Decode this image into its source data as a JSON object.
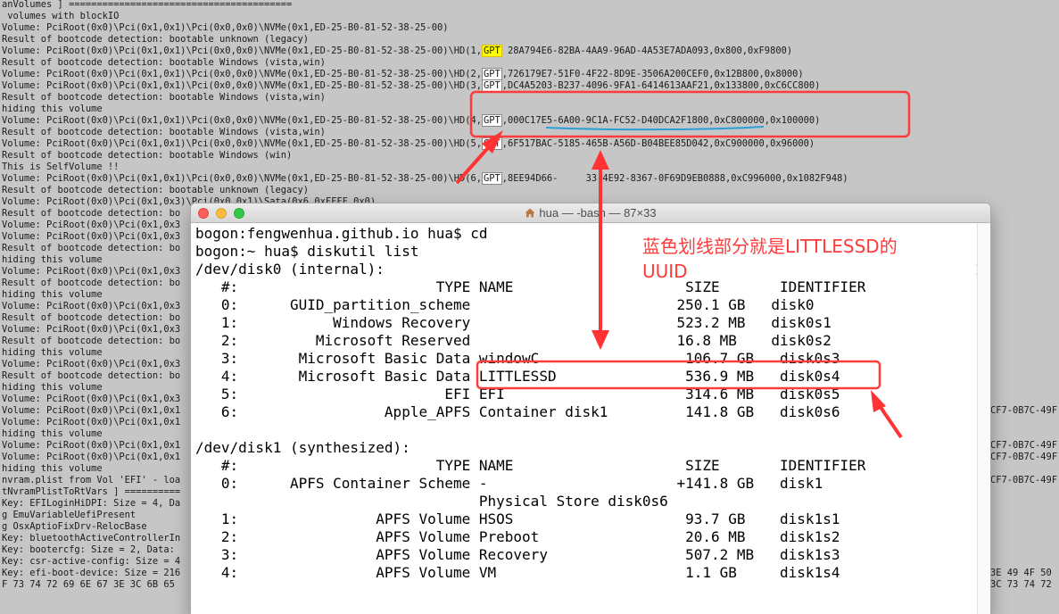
{
  "background_log": {
    "lines": [
      "anVolumes ] ========================================",
      " volumes with blockIO",
      "Volume: PciRoot(0x0)\\Pci(0x1,0x1)\\Pci(0x0,0x0)\\NVMe(0x1,ED-25-B0-81-52-38-25-00)",
      "Result of bootcode detection: bootable unknown (legacy)",
      "Volume: PciRoot(0x0)\\Pci(0x1,0x1)\\Pci(0x0,0x0)\\NVMe(0x1,ED-25-B0-81-52-38-25-00)\\HD(1,",
      "Result of bootcode detection: bootable Windows (vista,win)",
      "Volume: PciRoot(0x0)\\Pci(0x1,0x1)\\Pci(0x0,0x0)\\NVMe(0x1,ED-25-B0-81-52-38-25-00)\\HD(2,",
      "Volume: PciRoot(0x0)\\Pci(0x1,0x1)\\Pci(0x0,0x0)\\NVMe(0x1,ED-25-B0-81-52-38-25-00)\\HD(3,",
      "Result of bootcode detection: bootable Windows (vista,win)",
      "hiding this volume",
      "Volume: PciRoot(0x0)\\Pci(0x1,0x1)\\Pci(0x0,0x0)\\NVMe(0x1,ED-25-B0-81-52-38-25-00)\\HD(4,",
      "Result of bootcode detection: bootable Windows (vista,win)",
      "Volume: PciRoot(0x0)\\Pci(0x1,0x1)\\Pci(0x0,0x0)\\NVMe(0x1,ED-25-B0-81-52-38-25-00)\\HD(5,",
      "Result of bootcode detection: bootable Windows (win)",
      "This is SelfVolume !!",
      "Volume: PciRoot(0x0)\\Pci(0x1,0x1)\\Pci(0x0,0x0)\\NVMe(0x1,ED-25-B0-81-52-38-25-00)\\HD(6,",
      "Result of bootcode detection: bootable unknown (legacy)",
      "Volume: PciRoot(0x0)\\Pci(0x1,0x3)\\Pci(0x0,0x1)\\Sata(0x6,0xFFFF,0x0)",
      "Result of bootcode detection: bo",
      "Volume: PciRoot(0x0)\\Pci(0x1,0x3",
      "Volume: PciRoot(0x0)\\Pci(0x1,0x3",
      "Result of bootcode detection: bo",
      "hiding this volume",
      "Volume: PciRoot(0x0)\\Pci(0x1,0x3",
      "Result of bootcode detection: bo",
      "hiding this volume",
      "Volume: PciRoot(0x0)\\Pci(0x1,0x3",
      "Result of bootcode detection: bo",
      "Volume: PciRoot(0x0)\\Pci(0x1,0x3",
      "Result of bootcode detection: bo",
      "hiding this volume",
      "Volume: PciRoot(0x0)\\Pci(0x1,0x3",
      "Result of bootcode detection: bo",
      "hiding this volume",
      "Volume: PciRoot(0x0)\\Pci(0x1,0x3",
      "Volume: PciRoot(0x0)\\Pci(0x1,0x1",
      "Volume: PciRoot(0x0)\\Pci(0x1,0x1",
      "hiding this volume",
      "Volume: PciRoot(0x0)\\Pci(0x1,0x1",
      "Volume: PciRoot(0x0)\\Pci(0x1,0x1",
      "hiding this volume",
      "nvram.plist from Vol 'EFI' - loa",
      "tNvramPlistToRtVars ] ==========",
      "Key: EFILoginHiDPI: Size = 4, Da",
      "g EmuVariableUefiPresent",
      "g OsxAptioFixDrv-RelocBase",
      "Key: bluetoothActiveControllerIn",
      "Key: bootercfg: Size = 2, Data:",
      "Key: csr-active-config: Size = 4",
      "Key: efi-boot-device: Size = 216",
      "F 73 74 72 69 6E 67 3E 3C 6B 65"
    ],
    "gpt_label": "GPT",
    "gpt_rows": [
      {
        "guid": "28A794E6-82BA-4AA9-96AD-4A53E7ADA093",
        "tail": ",0x800,0xF9800)"
      },
      {
        "guid": "726179E7-51F0-4F22-8D9E-3506A200CEF0",
        "tail": ",0x12B800,0x8000)"
      },
      {
        "guid": "DC4A5203-B237-4096-9FA1-6414613AAF21",
        "tail": ",0x133800,0xC6CC800)"
      },
      {
        "guid": "000C17E5-6A00-9C1A-FC52-D40DCA2F1800",
        "tail": ",0xC800000,0x100000)"
      },
      {
        "guid": "6F517BAC-5185-465B-A56D-B04BEE85D042",
        "tail": ",0xC900000,0x96000)"
      },
      {
        "guid": "8EE94D66-     33-4E92-8367-0F69D9EB0888",
        "tail": ",0xC996000,0x1082F948)"
      }
    ],
    "right_fragments": [
      "CF7-0B7C-49F",
      "CF7-0B7C-49F",
      "CF7-0B7C-49F",
      "CF7-0B7C-49F",
      "3E 49 4F 50",
      "3C 73 74 72"
    ]
  },
  "terminal": {
    "title": "hua — -bash — 87×33",
    "lines": [
      "bogon:fengwenhua.github.io hua$ cd",
      "bogon:~ hua$ diskutil list",
      "/dev/disk0 (internal):",
      "   #:                       TYPE NAME                    SIZE       IDENTIFIER",
      "   0:      GUID_partition_scheme                        250.1 GB   disk0",
      "   1:           Windows Recovery                        523.2 MB   disk0s1",
      "   2:         Microsoft Reserved                        16.8 MB    disk0s2",
      "   3:       Microsoft Basic Data windowC                 106.7 GB   disk0s3",
      "   4:       Microsoft Basic Data LITTLESSD               536.9 MB   disk0s4",
      "   5:                        EFI EFI                     314.6 MB   disk0s5",
      "   6:                 Apple_APFS Container disk1         141.8 GB   disk0s6",
      "",
      "/dev/disk1 (synthesized):",
      "   #:                       TYPE NAME                    SIZE       IDENTIFIER",
      "   0:      APFS Container Scheme -                      +141.8 GB   disk1",
      "                                 Physical Store disk0s6",
      "   1:                APFS Volume HSOS                    93.7 GB    disk1s1",
      "   2:                APFS Volume Preboot                 20.6 MB    disk1s2",
      "   3:                APFS Volume Recovery                507.2 MB   disk1s3",
      "   4:                APFS Volume VM                      1.1 GB     disk1s4"
    ]
  },
  "annotation": {
    "note_line1": "蓝色划线部分就是LITTLESSD的",
    "note_line2": "UUID",
    "box_color": "#ff3b3b",
    "arrow_color": "#ff3333",
    "underline_color": "#2a9fd6"
  }
}
